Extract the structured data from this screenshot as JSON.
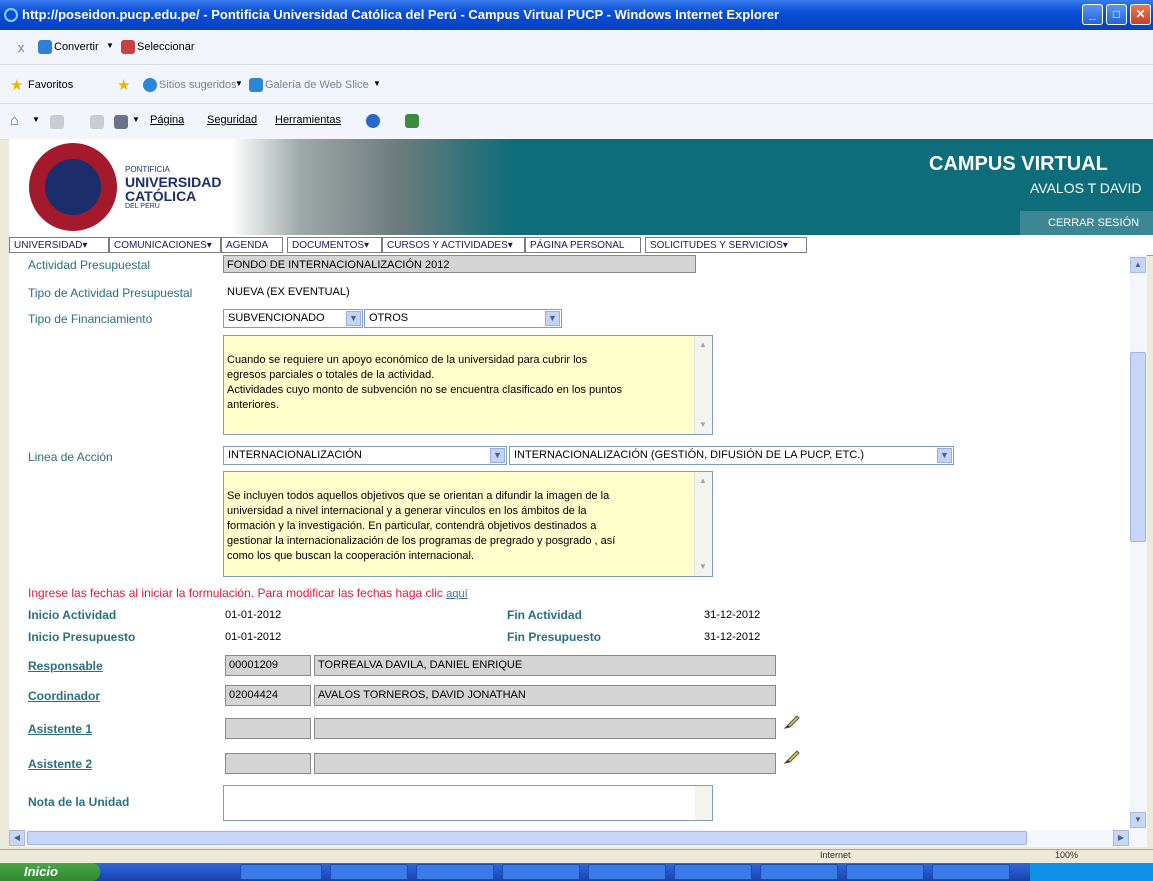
{
  "window": {
    "title": "http://poseidon.pucp.edu.pe/ - Pontificia Universidad Católica del Perú - Campus Virtual PUCP - Windows Internet Explorer"
  },
  "toolbar1": {
    "close_x": "x",
    "convertir": "Convertir",
    "seleccionar": "Seleccionar"
  },
  "favorites_bar": {
    "favoritos": "Favoritos",
    "sitios": "Sitios sugeridos",
    "galeria": "Galería de Web Slice"
  },
  "command_bar": {
    "pagina": "Página",
    "seguridad": "Seguridad",
    "herramientas": "Herramientas"
  },
  "header": {
    "logo_line1": "PONTIFICIA",
    "logo_line2": "UNIVERSIDAD",
    "logo_line3": "CATÓLICA",
    "logo_line4": "DEL PERÚ",
    "seal_text": "ET LUX IN TENEBRIS LUCET",
    "seal_year": "MCMXVII",
    "campus": "CAMPUS VIRTUAL",
    "user": "AVALOS T DAVID",
    "logout": "CERRAR SESIÓN"
  },
  "menu": {
    "items": [
      "UNIVERSIDAD",
      "COMUNICACIONES",
      "AGENDA",
      "DOCUMENTOS",
      "CURSOS Y ACTIVIDADES",
      "PÁGINA PERSONAL",
      "SOLICITUDES Y SERVICIOS"
    ]
  },
  "form": {
    "actividad_label": "Actividad Presupuestal",
    "actividad_value": "FONDO DE INTERNACIONALIZACIÓN 2012",
    "tipo_actividad_label": "Tipo de Actividad Presupuestal",
    "tipo_actividad_value": "NUEVA (EX EVENTUAL)",
    "financiamiento_label": "Tipo de Financiamiento",
    "financiamiento_select1": "SUBVENCIONADO",
    "financiamiento_select2": "OTROS",
    "financiamiento_desc": "Cuando se requiere un apoyo económico de la universidad para cubrir los\negresos  parciales o totales de la actividad.\nActividades cuyo monto de subvención no se encuentra clasificado en los puntos\nanteriores.",
    "linea_label": "Linea de Acción",
    "linea_select1": "INTERNACIONALIZACIÓN",
    "linea_select2": "INTERNACIONALIZACIÓN (GESTIÓN, DIFUSIÓN DE LA PUCP, ETC.)",
    "linea_desc": "Se incluyen todos aquellos objetivos que se orientan a difundir la imagen de la\nuniversidad a nivel internacional y a generar vínculos en los ámbitos de la\nformación y la investigación. En particular, contendrá objetivos destinados a\ngestionar la internacionalización de los programas de pregrado y posgrado , así\ncomo los que buscan la cooperación internacional.",
    "fechas_msg": "Ingrese las fechas al iniciar la formulación. Para modificar las fechas haga clic",
    "fechas_link": "aquí",
    "inicio_actividad_label": "Inicio Actividad",
    "inicio_actividad_value": "01-01-2012",
    "fin_actividad_label": "Fin Actividad",
    "fin_actividad_value": "31-12-2012",
    "inicio_presupuesto_label": "Inicio Presupuesto",
    "inicio_presupuesto_value": "01-01-2012",
    "fin_presupuesto_label": "Fin Presupuesto",
    "fin_presupuesto_value": "31-12-2012",
    "responsable_label": "Responsable",
    "responsable_code": "00001209",
    "responsable_name": "TORREALVA DAVILA, DANIEL ENRIQUE",
    "coordinador_label": "Coordinador",
    "coordinador_code": "02004424",
    "coordinador_name": "AVALOS TORNEROS, DAVID JONATHAN",
    "asistente1_label": "Asistente 1",
    "asistente2_label": "Asistente 2",
    "nota_label": "Nota de la Unidad"
  },
  "status": {
    "zone": "Internet",
    "zoom": "100%"
  },
  "taskbar": {
    "start": "Inicio"
  },
  "colors": {
    "header_teal": "#0e6d7a",
    "label_teal": "#2a6f80",
    "notice_red": "#e8163c",
    "textarea_yellow": "#ffffcc"
  }
}
